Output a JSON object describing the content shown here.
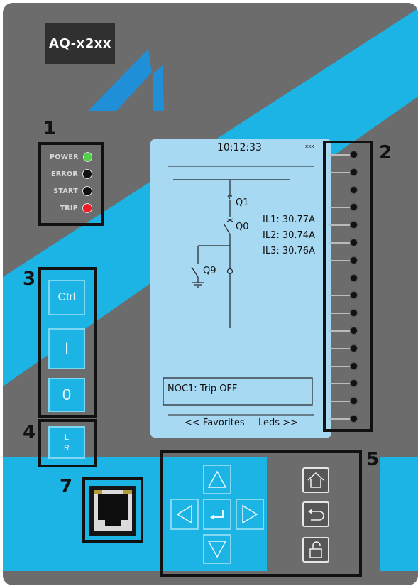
{
  "device": {
    "model": "AQ-x2xx"
  },
  "callouts": {
    "leds": "1",
    "side_leds": "2",
    "control_buttons": "3",
    "local_remote": "4",
    "navigation": "5",
    "ethernet": "7"
  },
  "status_leds": [
    {
      "label": "POWER",
      "color": "#52d14b"
    },
    {
      "label": "ERROR",
      "color": "#101010"
    },
    {
      "label": "START",
      "color": "#101010"
    },
    {
      "label": "TRIP",
      "color": "#ee1b24"
    }
  ],
  "buttons": {
    "ctrl": "Ctrl",
    "on": "I",
    "off": "0",
    "lr_top": "L",
    "lr_bottom": "R"
  },
  "lcd": {
    "time": "10:12:33",
    "corner": "xxx",
    "q1": "Q1",
    "q0": "Q0",
    "q9": "Q9",
    "il1": "IL1: 30.77A",
    "il2": "IL2: 30.74A",
    "il3": "IL3: 30.76A",
    "message": "NOC1: Trip OFF",
    "nav_left": "<< Favorites",
    "nav_right": "Leds >>"
  },
  "side_led_count": 16,
  "colors": {
    "panel_gray": "#6c6c6c",
    "accent_cyan": "#1bb4e4",
    "logo_blue": "#1f8fd8",
    "lcd_bg": "#a8d9f3",
    "power_green": "#52d14b",
    "trip_red": "#ee1b24"
  },
  "icons": {
    "up": "arrow-up-icon",
    "down": "arrow-down-icon",
    "left": "arrow-left-icon",
    "right": "arrow-right-icon",
    "enter": "enter-icon",
    "home": "home-icon",
    "back": "back-icon",
    "unlock": "unlock-icon"
  }
}
